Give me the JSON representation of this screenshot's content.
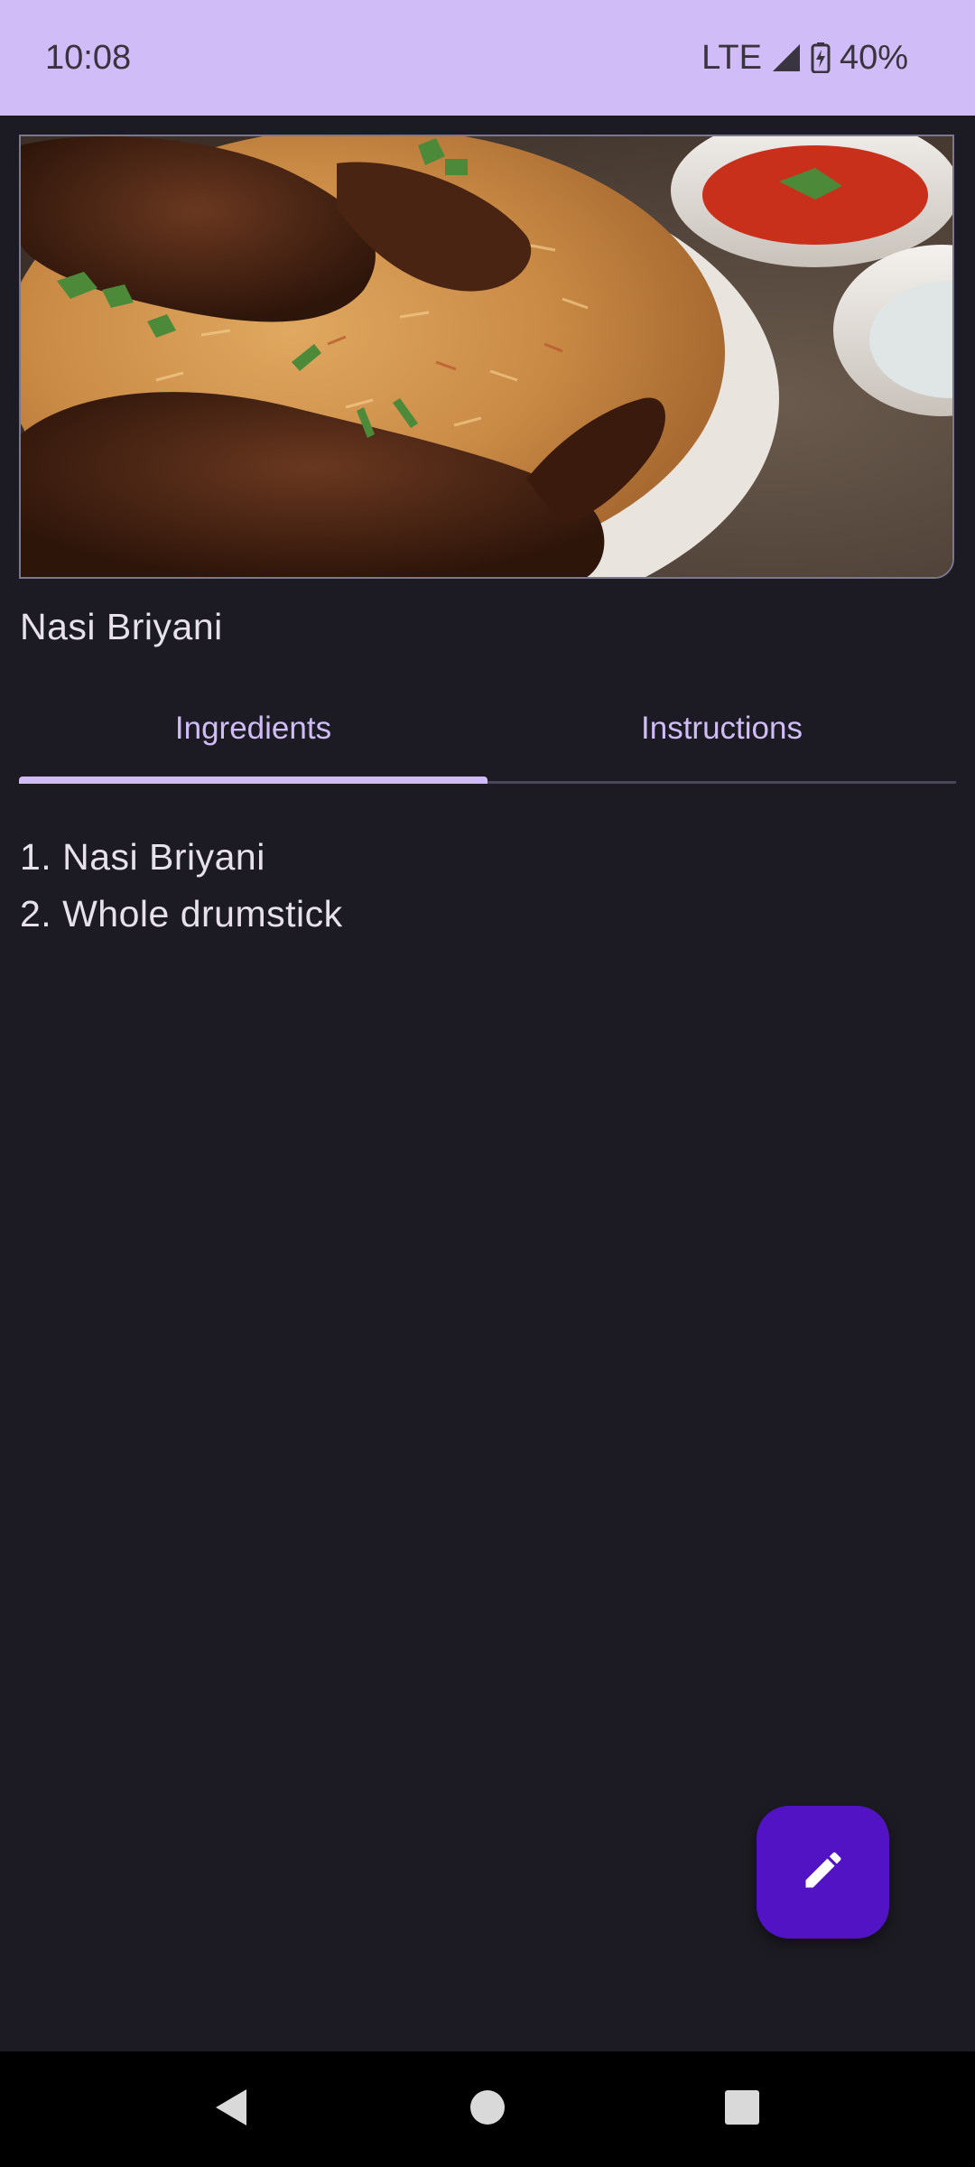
{
  "status_bar": {
    "time": "10:08",
    "network": "LTE",
    "battery": "40%",
    "icons": [
      "signal-icon",
      "battery-charging-icon"
    ]
  },
  "recipe": {
    "title": "Nasi Briyani",
    "image_icon": "food-photo"
  },
  "tabs": [
    {
      "label": "Ingredients",
      "selected": true
    },
    {
      "label": "Instructions",
      "selected": false
    }
  ],
  "ingredients": [
    "1. Nasi Briyani",
    "2. Whole drumstick"
  ],
  "fab": {
    "icon": "pencil-icon"
  },
  "nav_bar": {
    "icons": [
      "back-icon",
      "home-icon",
      "recents-icon"
    ]
  },
  "colors": {
    "accent": "#d0bcf6",
    "background": "#1c1b23",
    "fab": "#5213c4",
    "text": "#e6e1ea"
  }
}
